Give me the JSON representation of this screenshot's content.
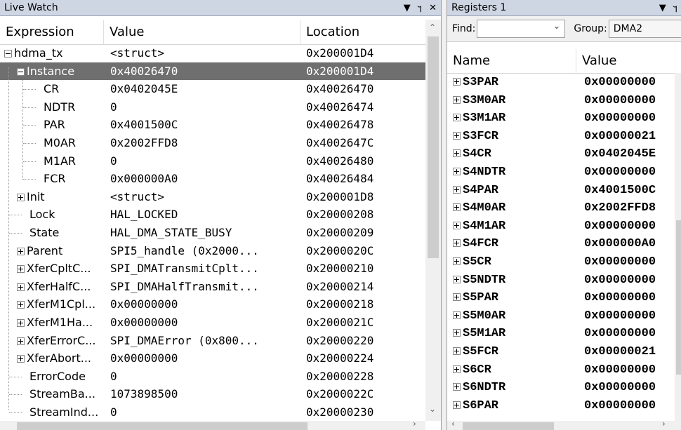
{
  "live_watch": {
    "title": "Live Watch",
    "columns": [
      "Expression",
      "Value",
      "Location"
    ],
    "rows": [
      {
        "name": "hdma_tx",
        "value": "<struct>",
        "location": "0x200001D4",
        "exp": "minus",
        "level": 0
      },
      {
        "name": "Instance",
        "value": "0x40026470",
        "location": "0x200001D4",
        "exp": "minus",
        "level": 1,
        "selected": true
      },
      {
        "name": "CR",
        "value": "0x0402045E",
        "location": "0x40026470",
        "level": 2
      },
      {
        "name": "NDTR",
        "value": "0",
        "location": "0x40026474",
        "level": 2
      },
      {
        "name": "PAR",
        "value": "0x4001500C",
        "location": "0x40026478",
        "level": 2
      },
      {
        "name": "M0AR",
        "value": "0x2002FFD8",
        "location": "0x4002647C",
        "level": 2
      },
      {
        "name": "M1AR",
        "value": "0",
        "location": "0x40026480",
        "level": 2
      },
      {
        "name": "FCR",
        "value": "0x000000A0",
        "location": "0x40026484",
        "level": 2
      },
      {
        "name": "Init",
        "value": "<struct>",
        "location": "0x200001D8",
        "exp": "plus",
        "level": 1
      },
      {
        "name": "Lock",
        "value": "HAL_LOCKED",
        "location": "0x20000208",
        "level": 1
      },
      {
        "name": "State",
        "value": "HAL_DMA_STATE_BUSY",
        "location": "0x20000209",
        "level": 1
      },
      {
        "name": "Parent",
        "value": "SPI5_handle (0x2000...",
        "location": "0x2000020C",
        "exp": "plus",
        "level": 1
      },
      {
        "name": "XferCpltC...",
        "value": "SPI_DMATransmitCplt...",
        "location": "0x20000210",
        "exp": "plus",
        "level": 1
      },
      {
        "name": "XferHalfC...",
        "value": "SPI_DMAHalfTransmit...",
        "location": "0x20000214",
        "exp": "plus",
        "level": 1
      },
      {
        "name": "XferM1Cpl...",
        "value": "0x00000000",
        "location": "0x20000218",
        "exp": "plus",
        "level": 1
      },
      {
        "name": "XferM1Ha...",
        "value": "0x00000000",
        "location": "0x2000021C",
        "exp": "plus",
        "level": 1
      },
      {
        "name": "XferErrorC...",
        "value": "SPI_DMAError (0x800...",
        "location": "0x20000220",
        "exp": "plus",
        "level": 1
      },
      {
        "name": "XferAbort...",
        "value": "0x00000000",
        "location": "0x20000224",
        "exp": "plus",
        "level": 1
      },
      {
        "name": "ErrorCode",
        "value": "0",
        "location": "0x20000228",
        "level": 1
      },
      {
        "name": "StreamBa...",
        "value": "1073898500",
        "location": "0x2000022C",
        "level": 1
      },
      {
        "name": "StreamInd...",
        "value": "0",
        "location": "0x20000230",
        "level": 1
      }
    ]
  },
  "registers": {
    "title": "Registers 1",
    "find_label": "Find:",
    "find_value": "",
    "group_label": "Group:",
    "group_value": "DMA2",
    "columns": [
      "Name",
      "Value"
    ],
    "rows": [
      {
        "name": "S3PAR",
        "value": "0x00000000"
      },
      {
        "name": "S3M0AR",
        "value": "0x00000000"
      },
      {
        "name": "S3M1AR",
        "value": "0x00000000"
      },
      {
        "name": "S3FCR",
        "value": "0x00000021"
      },
      {
        "name": "S4CR",
        "value": "0x0402045E"
      },
      {
        "name": "S4NDTR",
        "value": "0x00000000"
      },
      {
        "name": "S4PAR",
        "value": "0x4001500C"
      },
      {
        "name": "S4M0AR",
        "value": "0x2002FFD8"
      },
      {
        "name": "S4M1AR",
        "value": "0x00000000"
      },
      {
        "name": "S4FCR",
        "value": "0x000000A0"
      },
      {
        "name": "S5CR",
        "value": "0x00000000"
      },
      {
        "name": "S5NDTR",
        "value": "0x00000000"
      },
      {
        "name": "S5PAR",
        "value": "0x00000000"
      },
      {
        "name": "S5M0AR",
        "value": "0x00000000"
      },
      {
        "name": "S5M1AR",
        "value": "0x00000000"
      },
      {
        "name": "S5FCR",
        "value": "0x00000021"
      },
      {
        "name": "S6CR",
        "value": "0x00000000"
      },
      {
        "name": "S6NDTR",
        "value": "0x00000000"
      },
      {
        "name": "S6PAR",
        "value": "0x00000000"
      }
    ]
  },
  "controls": {
    "dropdown_glyph": "▼",
    "pin_glyph": "ꟾ",
    "close_glyph": "✕",
    "combo_arrow": "⌄"
  }
}
